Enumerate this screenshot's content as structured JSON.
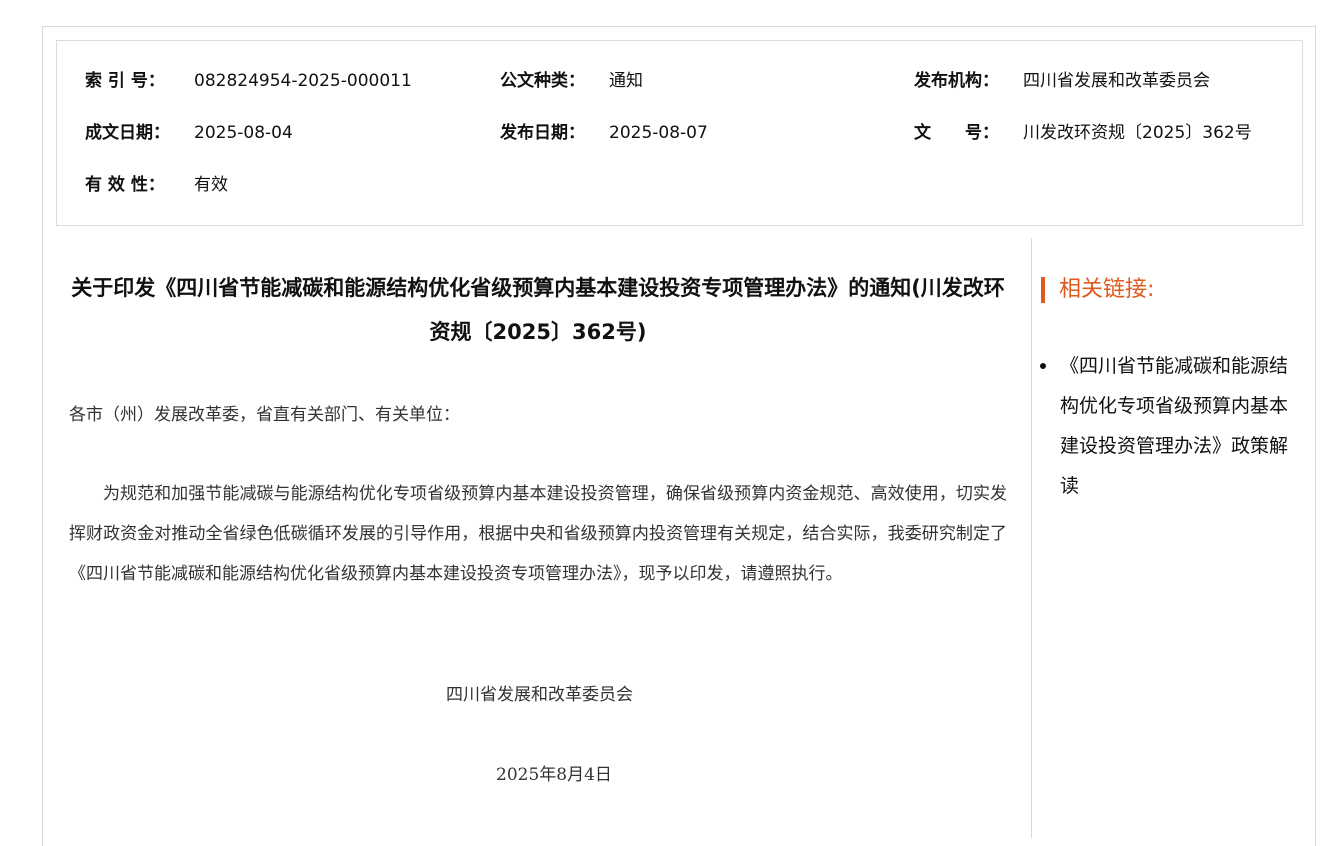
{
  "meta": {
    "index_label": "索 引 号：",
    "index_value": "082824954-2025-000011",
    "doc_type_label": "公文种类：",
    "doc_type_value": "通知",
    "issuer_label": "发布机构：",
    "issuer_value": "四川省发展和改革委员会",
    "written_date_label": "成文日期：",
    "written_date_value": "2025-08-04",
    "publish_date_label": "发布日期：",
    "publish_date_value": "2025-08-07",
    "doc_number_label": "文　　号：",
    "doc_number_value": "川发改环资规〔2025〕362号",
    "validity_label": "有 效 性：",
    "validity_value": "有效"
  },
  "article": {
    "title": "关于印发《四川省节能减碳和能源结构优化省级预算内基本建设投资专项管理办法》的通知(川发改环资规〔2025〕362号)",
    "salutation": "各市（州）发展改革委，省直有关部门、有关单位：",
    "body": "为规范和加强节能减碳与能源结构优化专项省级预算内基本建设投资管理，确保省级预算内资金规范、高效使用，切实发挥财政资金对推动全省绿色低碳循环发展的引导作用，根据中央和省级预算内投资管理有关规定，结合实际，我委研究制定了《四川省节能减碳和能源结构优化省级预算内基本建设投资专项管理办法》，现予以印发，请遵照执行。",
    "signer": "四川省发展和改革委员会",
    "sign_date": "2025年8月4日"
  },
  "related": {
    "heading": "相关链接:",
    "items": [
      "《四川省节能减碳和能源结构优化专项省级预算内基本建设投资管理办法》政策解读"
    ]
  },
  "colors": {
    "accent": "#e05a1e",
    "border": "#d9d9d9"
  }
}
